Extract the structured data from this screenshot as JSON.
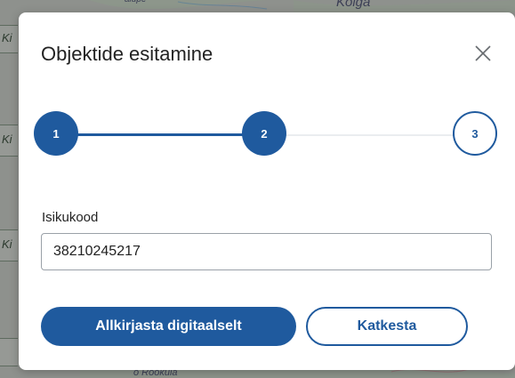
{
  "map": {
    "labels": {
      "kolga": "Kolga",
      "rookula": "o Rookula",
      "top_fragment": "alupe"
    },
    "side_fragments": [
      "Ki",
      "Ki",
      "Ki"
    ]
  },
  "dialog": {
    "title": "Objektide esitamine",
    "close_icon": "close-icon",
    "steps": [
      {
        "label": "1",
        "state": "done"
      },
      {
        "label": "2",
        "state": "current"
      },
      {
        "label": "3",
        "state": "pending"
      }
    ],
    "field": {
      "label": "Isikukood",
      "value": "38210245217"
    },
    "buttons": {
      "primary": "Allkirjasta digitaalselt",
      "secondary": "Katkesta"
    }
  },
  "colors": {
    "accent": "#1f5a9e",
    "backdrop": "#8e918d",
    "text": "#222222",
    "inactive_line": "#eaedf0"
  }
}
